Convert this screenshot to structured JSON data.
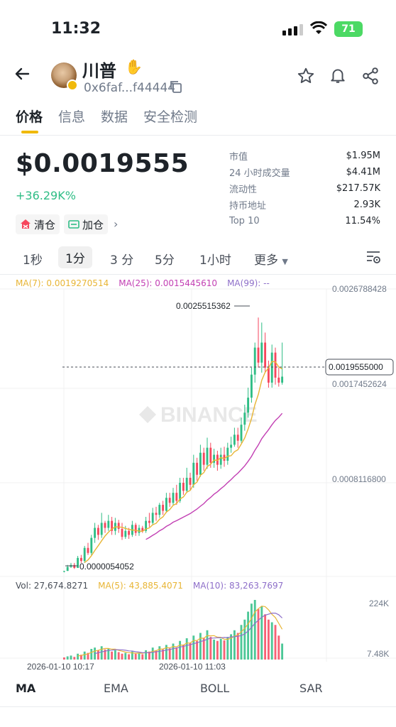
{
  "status": {
    "time": "11:32",
    "battery": "71"
  },
  "header": {
    "token_name": "川普",
    "address": "0x6faf...f44444"
  },
  "tabs": [
    {
      "label": "价格",
      "active": true
    },
    {
      "label": "信息",
      "active": false
    },
    {
      "label": "数据",
      "active": false
    },
    {
      "label": "安全检测",
      "active": false
    }
  ],
  "price": {
    "value": "$0.0019555",
    "change": "+36.29K%"
  },
  "actions": {
    "clear_label": "清仓",
    "add_label": "加仓"
  },
  "stats": [
    {
      "label": "市值",
      "value": "$1.95M"
    },
    {
      "label": "24 小时成交量",
      "value": "$4.41M"
    },
    {
      "label": "流动性",
      "value": "$217.57K"
    },
    {
      "label": "持币地址",
      "value": "2.93K"
    },
    {
      "label": "Top 10",
      "value": "11.54%"
    }
  ],
  "intervals": [
    "1秒",
    "1分",
    "3 分",
    "5分",
    "1小时",
    "更多"
  ],
  "active_interval": "1分",
  "indicators": {
    "ma7": "MA(7): 0.0019270514",
    "ma25": "MA(25): 0.0015445610",
    "ma99": "MA(99): --",
    "vol": "Vol: 27,674.8271",
    "vma5": "MA(5): 43,885.4071",
    "vma10": "MA(10): 83,263.7697"
  },
  "indicator_tabs": [
    "MA",
    "EMA",
    "BOLL",
    "SAR"
  ],
  "colors": {
    "up": "#2ebd85",
    "down": "#f6465d",
    "accent": "#f0b90b",
    "ma7": "#e8b535",
    "ma25": "#c23fb3",
    "ma99": "#8e6fc9"
  },
  "chart_data": {
    "type": "candlestick",
    "watermark": "BINANCE",
    "price_axis": [
      "0.0026788428",
      "0.0017452624",
      "0.0008116800"
    ],
    "last_price": "0.0019555000",
    "high_label": "0.0025515362",
    "low_label": "0.0000054052",
    "volume_axis": [
      "224K",
      "7.48K"
    ],
    "time_labels": [
      "2026-01-10 10:17",
      "2026-01-10 11:03"
    ],
    "price_range": [
      0,
      0.0028
    ],
    "candles": [
      [
        2e-05,
        2e-05,
        2e-05,
        5e-06
      ],
      [
        2e-05,
        6e-05,
        8e-05,
        2e-05
      ],
      [
        6e-05,
        8e-05,
        0.0001,
        5e-05
      ],
      [
        8e-05,
        5e-05,
        0.0001,
        4e-05
      ],
      [
        5e-05,
        0.00015,
        0.00017,
        5e-05
      ],
      [
        0.00015,
        0.00012,
        0.00018,
        0.0001
      ],
      [
        0.00012,
        0.00025,
        0.00027,
        0.0001
      ],
      [
        0.00025,
        0.0002,
        0.0003,
        0.00018
      ],
      [
        0.0002,
        0.00035,
        0.00038,
        0.00018
      ],
      [
        0.00035,
        0.00045,
        0.0005,
        0.0003
      ],
      [
        0.00045,
        0.00038,
        0.00048,
        0.00033
      ],
      [
        0.00038,
        0.0005,
        0.0006,
        0.00035
      ],
      [
        0.0005,
        0.00045,
        0.00052,
        0.0004
      ],
      [
        0.00045,
        0.00052,
        0.00058,
        0.00042
      ],
      [
        0.00052,
        0.00042,
        0.00056,
        0.00038
      ],
      [
        0.00042,
        0.0005,
        0.00055,
        0.00038
      ],
      [
        0.0005,
        0.00044,
        0.00053,
        0.0004
      ],
      [
        0.00044,
        0.00036,
        0.0005,
        0.00033
      ],
      [
        0.00036,
        0.00042,
        0.00047,
        0.00034
      ],
      [
        0.00042,
        0.00038,
        0.00045,
        0.00034
      ],
      [
        0.00038,
        0.00048,
        0.00052,
        0.00036
      ],
      [
        0.00048,
        0.0004,
        0.0005,
        0.00037
      ],
      [
        0.0004,
        0.00045,
        0.00048,
        0.00037
      ],
      [
        0.00045,
        0.00042,
        0.00047,
        0.0004
      ],
      [
        0.00042,
        0.00052,
        0.00056,
        0.0004
      ],
      [
        0.00052,
        0.0005,
        0.0006,
        0.00046
      ],
      [
        0.0005,
        0.0006,
        0.00065,
        0.00048
      ],
      [
        0.0006,
        0.00058,
        0.00066,
        0.00052
      ],
      [
        0.00058,
        0.00068,
        0.0007,
        0.00055
      ],
      [
        0.00068,
        0.00062,
        0.00072,
        0.00058
      ],
      [
        0.00062,
        0.00075,
        0.0008,
        0.0006
      ],
      [
        0.00075,
        0.0007,
        0.0008,
        0.00066
      ],
      [
        0.0007,
        0.0008,
        0.00085,
        0.00068
      ],
      [
        0.0008,
        0.00072,
        0.00088,
        0.00068
      ],
      [
        0.00072,
        0.0009,
        0.00095,
        0.0007
      ],
      [
        0.0009,
        0.00082,
        0.00095,
        0.00078
      ],
      [
        0.00082,
        0.00095,
        0.00105,
        0.0008
      ],
      [
        0.00095,
        0.00088,
        0.001,
        0.00082
      ],
      [
        0.00088,
        0.0011,
        0.00118,
        0.00085
      ],
      [
        0.0011,
        0.00098,
        0.00115,
        0.00092
      ],
      [
        0.00098,
        0.0012,
        0.00128,
        0.00096
      ],
      [
        0.0012,
        0.00108,
        0.00125,
        0.00102
      ],
      [
        0.00108,
        0.00125,
        0.00135,
        0.00104
      ],
      [
        0.00125,
        0.0011,
        0.0013,
        0.00105
      ],
      [
        0.0011,
        0.00118,
        0.00124,
        0.00105
      ],
      [
        0.00118,
        0.00108,
        0.00122,
        0.00102
      ],
      [
        0.00108,
        0.00118,
        0.00125,
        0.00104
      ],
      [
        0.00118,
        0.00112,
        0.00126,
        0.00106
      ],
      [
        0.00112,
        0.00125,
        0.0013,
        0.00108
      ],
      [
        0.00125,
        0.00128,
        0.00136,
        0.0012
      ],
      [
        0.00128,
        0.00138,
        0.00145,
        0.00126
      ],
      [
        0.00138,
        0.00132,
        0.00145,
        0.00125
      ],
      [
        0.00132,
        0.00148,
        0.00155,
        0.0013
      ],
      [
        0.00148,
        0.0016,
        0.00168,
        0.00142
      ],
      [
        0.0016,
        0.00175,
        0.00185,
        0.00155
      ],
      [
        0.00175,
        0.00198,
        0.00205,
        0.0017
      ],
      [
        0.00198,
        0.00225,
        0.0023,
        0.0019
      ],
      [
        0.00225,
        0.0021,
        0.00255,
        0.00205
      ],
      [
        0.0021,
        0.0023,
        0.0025,
        0.002
      ],
      [
        0.0023,
        0.00205,
        0.0024,
        0.002
      ],
      [
        0.00205,
        0.0019,
        0.00212,
        0.00185
      ],
      [
        0.0019,
        0.0022,
        0.00228,
        0.00185
      ],
      [
        0.0022,
        0.00195,
        0.00225,
        0.00188
      ],
      [
        0.00195,
        0.0019,
        0.00205,
        0.00186
      ],
      [
        0.0019,
        0.00196,
        0.0023,
        0.00188
      ]
    ],
    "volumes": [
      8,
      12,
      15,
      10,
      22,
      18,
      30,
      25,
      40,
      45,
      35,
      50,
      38,
      42,
      30,
      35,
      28,
      22,
      25,
      20,
      30,
      22,
      25,
      20,
      35,
      30,
      45,
      35,
      50,
      38,
      55,
      42,
      60,
      45,
      70,
      55,
      80,
      62,
      90,
      70,
      100,
      80,
      110,
      85,
      75,
      70,
      78,
      72,
      85,
      95,
      110,
      100,
      130,
      150,
      180,
      210,
      224,
      190,
      200,
      170,
      150,
      140,
      130,
      90,
      60
    ],
    "vol_up": [
      0,
      1,
      1,
      0,
      1,
      0,
      1,
      0,
      1,
      1,
      0,
      1,
      0,
      1,
      0,
      1,
      0,
      0,
      1,
      0,
      1,
      0,
      1,
      0,
      1,
      0,
      1,
      0,
      1,
      0,
      1,
      0,
      1,
      0,
      1,
      0,
      1,
      0,
      1,
      0,
      1,
      0,
      1,
      0,
      1,
      0,
      1,
      0,
      1,
      1,
      1,
      0,
      1,
      1,
      1,
      1,
      1,
      0,
      1,
      0,
      0,
      1,
      0,
      0,
      1
    ]
  }
}
